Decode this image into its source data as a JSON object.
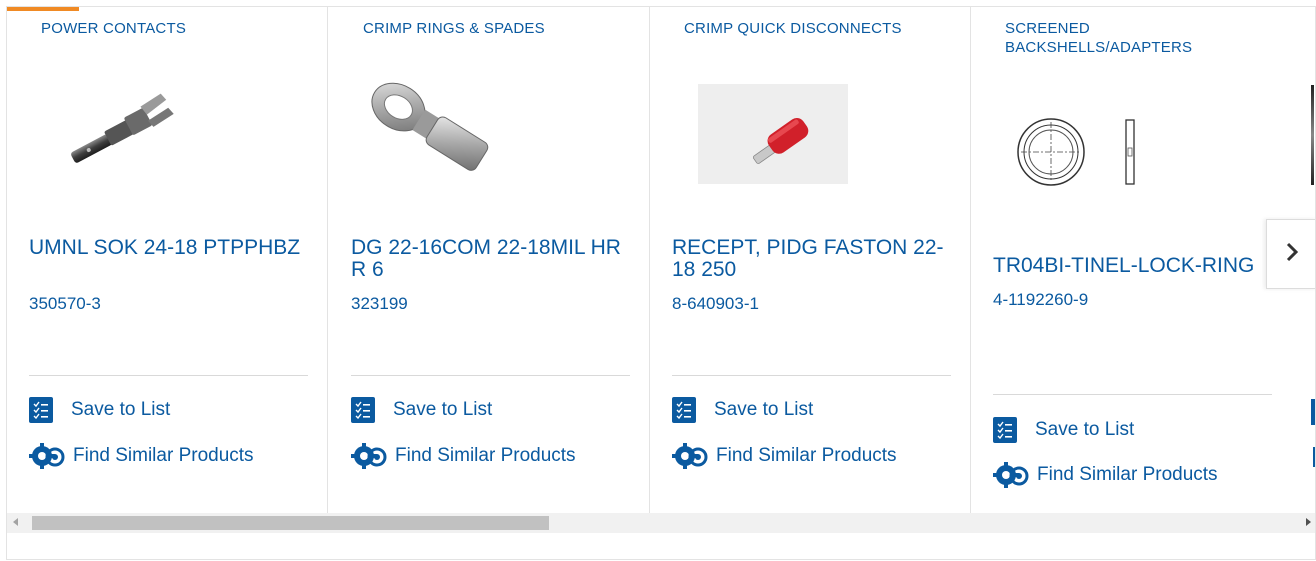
{
  "products": [
    {
      "category": "POWER CONTACTS",
      "title": "UMNL SOK 24-18 PTPPHBZ",
      "part_number": "350570-3",
      "save_label": "Save to List",
      "similar_label": "Find Similar Products",
      "image_icon": "power-contact-image"
    },
    {
      "category": "CRIMP RINGS & SPADES",
      "title": "DG 22-16COM 22-18MIL HR R 6",
      "part_number": "323199",
      "save_label": "Save to List",
      "similar_label": "Find Similar Products",
      "image_icon": "ring-terminal-image"
    },
    {
      "category": "CRIMP QUICK DISCONNECTS",
      "title": "RECEPT, PIDG FASTON 22-18 250",
      "part_number": "8-640903-1",
      "save_label": "Save to List",
      "similar_label": "Find Similar Products",
      "image_icon": "quick-disconnect-image"
    },
    {
      "category": "SCREENED BACKSHELLS/ADAPTERS",
      "title": "TR04BI-TINEL-LOCK-RING",
      "part_number": "4-1192260-9",
      "save_label": "Save to List",
      "similar_label": "Find Similar Products",
      "image_icon": "lock-ring-drawing-image"
    }
  ],
  "carousel": {
    "next_icon": "chevron-right-icon"
  },
  "scrollbar": {
    "left_icon": "scroll-left-arrow",
    "right_icon": "scroll-right-arrow"
  },
  "colors": {
    "brand_blue": "#0b5aa0",
    "active_tab": "#f08a24",
    "divider": "#d9d9d9"
  }
}
